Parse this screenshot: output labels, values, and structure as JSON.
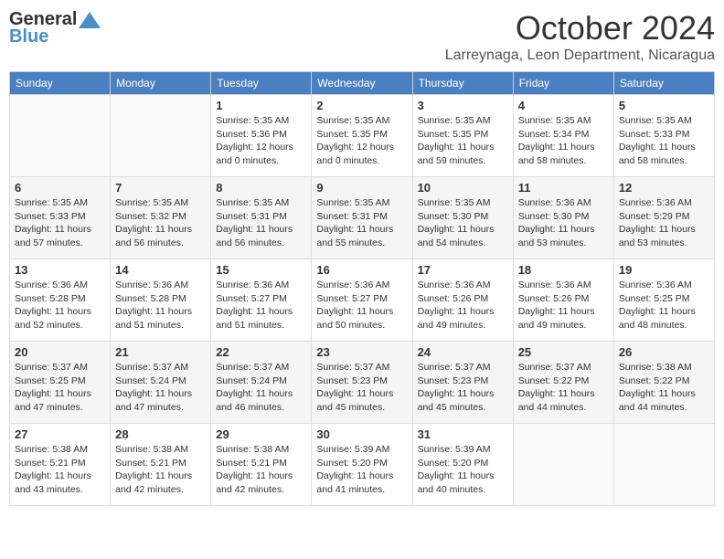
{
  "header": {
    "logo_general": "General",
    "logo_blue": "Blue",
    "month_title": "October 2024",
    "location": "Larreynaga, Leon Department, Nicaragua"
  },
  "weekdays": [
    "Sunday",
    "Monday",
    "Tuesday",
    "Wednesday",
    "Thursday",
    "Friday",
    "Saturday"
  ],
  "weeks": [
    [
      {
        "day": "",
        "info": ""
      },
      {
        "day": "",
        "info": ""
      },
      {
        "day": "1",
        "info": "Sunrise: 5:35 AM\nSunset: 5:36 PM\nDaylight: 12 hours\nand 0 minutes."
      },
      {
        "day": "2",
        "info": "Sunrise: 5:35 AM\nSunset: 5:35 PM\nDaylight: 12 hours\nand 0 minutes."
      },
      {
        "day": "3",
        "info": "Sunrise: 5:35 AM\nSunset: 5:35 PM\nDaylight: 11 hours\nand 59 minutes."
      },
      {
        "day": "4",
        "info": "Sunrise: 5:35 AM\nSunset: 5:34 PM\nDaylight: 11 hours\nand 58 minutes."
      },
      {
        "day": "5",
        "info": "Sunrise: 5:35 AM\nSunset: 5:33 PM\nDaylight: 11 hours\nand 58 minutes."
      }
    ],
    [
      {
        "day": "6",
        "info": "Sunrise: 5:35 AM\nSunset: 5:33 PM\nDaylight: 11 hours\nand 57 minutes."
      },
      {
        "day": "7",
        "info": "Sunrise: 5:35 AM\nSunset: 5:32 PM\nDaylight: 11 hours\nand 56 minutes."
      },
      {
        "day": "8",
        "info": "Sunrise: 5:35 AM\nSunset: 5:31 PM\nDaylight: 11 hours\nand 56 minutes."
      },
      {
        "day": "9",
        "info": "Sunrise: 5:35 AM\nSunset: 5:31 PM\nDaylight: 11 hours\nand 55 minutes."
      },
      {
        "day": "10",
        "info": "Sunrise: 5:35 AM\nSunset: 5:30 PM\nDaylight: 11 hours\nand 54 minutes."
      },
      {
        "day": "11",
        "info": "Sunrise: 5:36 AM\nSunset: 5:30 PM\nDaylight: 11 hours\nand 53 minutes."
      },
      {
        "day": "12",
        "info": "Sunrise: 5:36 AM\nSunset: 5:29 PM\nDaylight: 11 hours\nand 53 minutes."
      }
    ],
    [
      {
        "day": "13",
        "info": "Sunrise: 5:36 AM\nSunset: 5:28 PM\nDaylight: 11 hours\nand 52 minutes."
      },
      {
        "day": "14",
        "info": "Sunrise: 5:36 AM\nSunset: 5:28 PM\nDaylight: 11 hours\nand 51 minutes."
      },
      {
        "day": "15",
        "info": "Sunrise: 5:36 AM\nSunset: 5:27 PM\nDaylight: 11 hours\nand 51 minutes."
      },
      {
        "day": "16",
        "info": "Sunrise: 5:36 AM\nSunset: 5:27 PM\nDaylight: 11 hours\nand 50 minutes."
      },
      {
        "day": "17",
        "info": "Sunrise: 5:36 AM\nSunset: 5:26 PM\nDaylight: 11 hours\nand 49 minutes."
      },
      {
        "day": "18",
        "info": "Sunrise: 5:36 AM\nSunset: 5:26 PM\nDaylight: 11 hours\nand 49 minutes."
      },
      {
        "day": "19",
        "info": "Sunrise: 5:36 AM\nSunset: 5:25 PM\nDaylight: 11 hours\nand 48 minutes."
      }
    ],
    [
      {
        "day": "20",
        "info": "Sunrise: 5:37 AM\nSunset: 5:25 PM\nDaylight: 11 hours\nand 47 minutes."
      },
      {
        "day": "21",
        "info": "Sunrise: 5:37 AM\nSunset: 5:24 PM\nDaylight: 11 hours\nand 47 minutes."
      },
      {
        "day": "22",
        "info": "Sunrise: 5:37 AM\nSunset: 5:24 PM\nDaylight: 11 hours\nand 46 minutes."
      },
      {
        "day": "23",
        "info": "Sunrise: 5:37 AM\nSunset: 5:23 PM\nDaylight: 11 hours\nand 45 minutes."
      },
      {
        "day": "24",
        "info": "Sunrise: 5:37 AM\nSunset: 5:23 PM\nDaylight: 11 hours\nand 45 minutes."
      },
      {
        "day": "25",
        "info": "Sunrise: 5:37 AM\nSunset: 5:22 PM\nDaylight: 11 hours\nand 44 minutes."
      },
      {
        "day": "26",
        "info": "Sunrise: 5:38 AM\nSunset: 5:22 PM\nDaylight: 11 hours\nand 44 minutes."
      }
    ],
    [
      {
        "day": "27",
        "info": "Sunrise: 5:38 AM\nSunset: 5:21 PM\nDaylight: 11 hours\nand 43 minutes."
      },
      {
        "day": "28",
        "info": "Sunrise: 5:38 AM\nSunset: 5:21 PM\nDaylight: 11 hours\nand 42 minutes."
      },
      {
        "day": "29",
        "info": "Sunrise: 5:38 AM\nSunset: 5:21 PM\nDaylight: 11 hours\nand 42 minutes."
      },
      {
        "day": "30",
        "info": "Sunrise: 5:39 AM\nSunset: 5:20 PM\nDaylight: 11 hours\nand 41 minutes."
      },
      {
        "day": "31",
        "info": "Sunrise: 5:39 AM\nSunset: 5:20 PM\nDaylight: 11 hours\nand 40 minutes."
      },
      {
        "day": "",
        "info": ""
      },
      {
        "day": "",
        "info": ""
      }
    ]
  ]
}
